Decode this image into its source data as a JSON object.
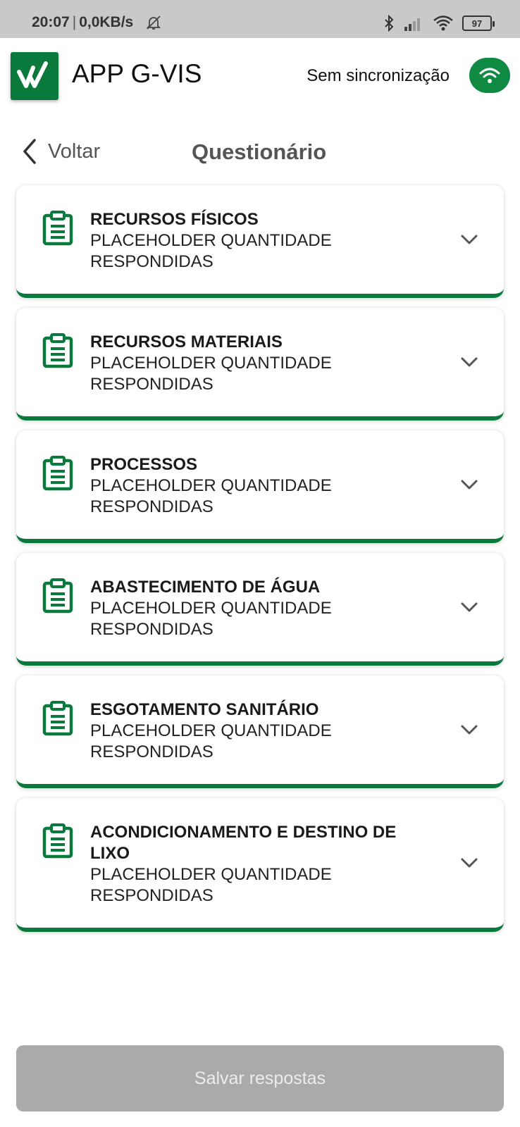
{
  "status_bar": {
    "time": "20:07",
    "separator": "|",
    "network_speed": "0,0KB/s",
    "battery": "97",
    "icons": [
      "bell-off-icon",
      "bluetooth-icon",
      "signal-icon",
      "wifi-icon",
      "battery-icon"
    ]
  },
  "header": {
    "app_title": "APP G-VIS",
    "sync_status": "Sem sincronização",
    "sync_icon": "wifi-icon",
    "brand_color": "#0a7a3c"
  },
  "nav": {
    "back_label": "Voltar",
    "page_title": "Questionário"
  },
  "sections": [
    {
      "title": "RECURSOS FÍSICOS",
      "subtitle": "PLACEHOLDER QUANTIDADE RESPONDIDAS"
    },
    {
      "title": "RECURSOS MATERIAIS",
      "subtitle": "PLACEHOLDER QUANTIDADE RESPONDIDAS"
    },
    {
      "title": "PROCESSOS",
      "subtitle": "PLACEHOLDER QUANTIDADE RESPONDIDAS"
    },
    {
      "title": "ABASTECIMENTO DE ÁGUA",
      "subtitle": "PLACEHOLDER QUANTIDADE RESPONDIDAS"
    },
    {
      "title": "ESGOTAMENTO SANITÁRIO",
      "subtitle": "PLACEHOLDER QUANTIDADE RESPONDIDAS"
    },
    {
      "title": "ACONDICIONAMENTO E DESTINO DE LIXO",
      "subtitle": "PLACEHOLDER QUANTIDADE RESPONDIDAS"
    }
  ],
  "footer": {
    "save_label": "Salvar respostas",
    "save_color": "#aaaaaa"
  }
}
